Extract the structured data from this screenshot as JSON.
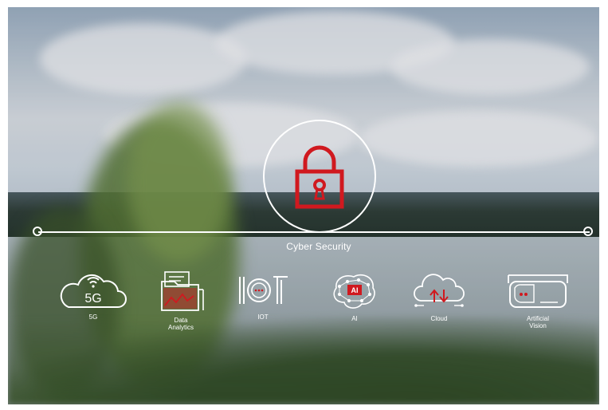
{
  "featured": {
    "label": "Cyber Security",
    "icon": "padlock-icon",
    "accent_color": "#d0191f"
  },
  "technologies": [
    {
      "label": "5G",
      "icon": "5g-cloud-icon",
      "badge": "5G"
    },
    {
      "label": "Data\nAnalytics",
      "icon": "data-analytics-folder-icon"
    },
    {
      "label": "IOT",
      "icon": "iot-icon"
    },
    {
      "label": "AI",
      "icon": "ai-brain-icon",
      "badge": "AI"
    },
    {
      "label": "Cloud",
      "icon": "cloud-sync-icon"
    },
    {
      "label": "Artificial\nVision",
      "icon": "vr-headset-icon"
    }
  ],
  "colors": {
    "line": "#ffffff",
    "accent": "#d0191f"
  }
}
